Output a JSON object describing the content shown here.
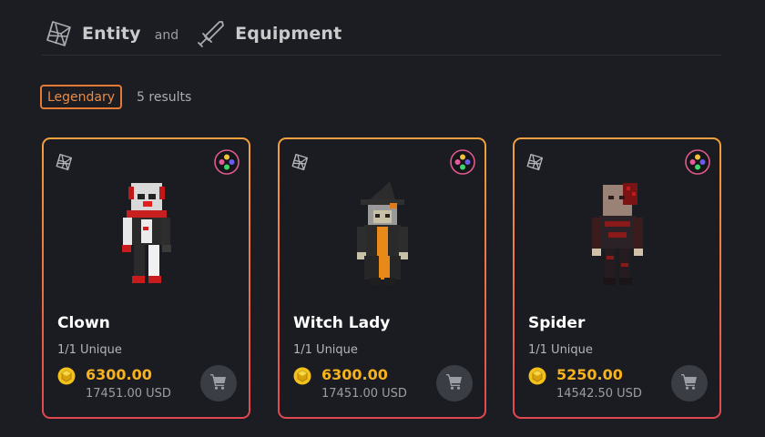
{
  "header": {
    "entity_label": "Entity",
    "and_label": "and",
    "equipment_label": "Equipment"
  },
  "filter": {
    "badge_label": "Legendary",
    "results_text": "5 results"
  },
  "colors": {
    "accent_orange": "#e47b34",
    "price_gold": "#f7b21d",
    "card_border_top": "#f2a13c",
    "card_border_bottom": "#e0474f"
  },
  "cards": [
    {
      "name": "Clown",
      "edition": "1/1 Unique",
      "price": "6300.00",
      "usd": "17451.00 USD",
      "type_icon": "cube-icon",
      "rarity_icon": "rarity-dots-icon",
      "action_icon": "cart-icon"
    },
    {
      "name": "Witch Lady",
      "edition": "1/1 Unique",
      "price": "6300.00",
      "usd": "17451.00 USD",
      "type_icon": "cube-icon",
      "rarity_icon": "rarity-dots-icon",
      "action_icon": "cart-icon"
    },
    {
      "name": "Spider",
      "edition": "1/1 Unique",
      "price": "5250.00",
      "usd": "14542.50 USD",
      "type_icon": "cube-icon",
      "rarity_icon": "rarity-dots-icon",
      "action_icon": "cart-icon"
    }
  ]
}
